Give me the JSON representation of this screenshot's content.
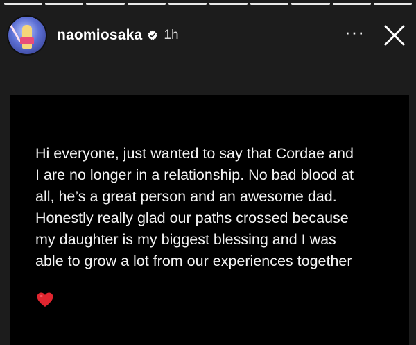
{
  "story": {
    "progress_segments": 10,
    "header": {
      "username": "naomiosaka",
      "time": "1h",
      "more_label": "···"
    },
    "message": "Hi everyone, just wanted to say that Cordae and\nI are no longer in a relationship. No bad blood at\nall, he’s a great person and an awesome dad.\nHonestly really glad our paths crossed because\nmy daughter is my biggest blessing and I was\nable to grow a lot from our experiences together",
    "emoji": "red-heart-icon"
  },
  "colors": {
    "background": "#1c1c1c",
    "card": "#000000",
    "heart": "#e0252f"
  }
}
